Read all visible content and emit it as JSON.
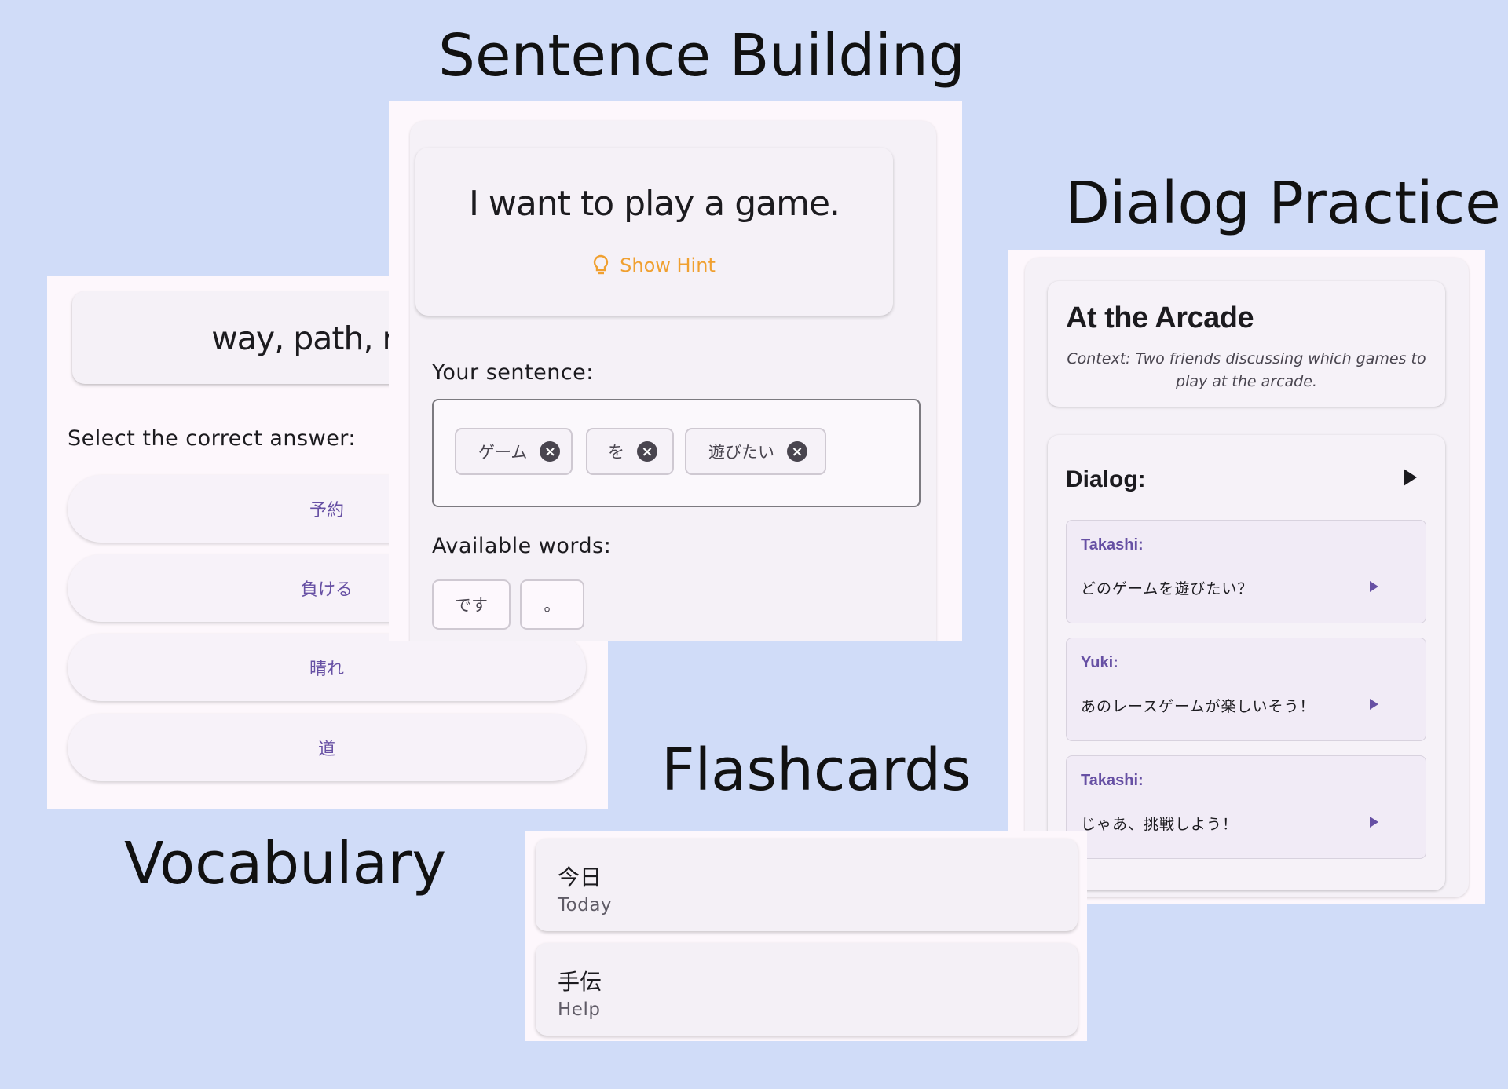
{
  "headings": {
    "sentence_building": "Sentence Building",
    "dialog_practice": "Dialog Practice",
    "flashcards": "Flashcards",
    "vocabulary": "Vocabulary"
  },
  "vocabulary": {
    "word": "way, path, road",
    "prompt": "Select the correct answer:",
    "options": [
      "予約",
      "負ける",
      "晴れ",
      "道"
    ]
  },
  "sentence_building": {
    "target": "I want to play a game.",
    "hint_label": "Show Hint",
    "your_sentence_label": "Your sentence:",
    "selected_words": [
      "ゲーム",
      "を",
      "遊びたい"
    ],
    "available_label": "Available words:",
    "available_words": [
      "です",
      "。"
    ]
  },
  "dialog": {
    "title": "At the Arcade",
    "context": "Context: Two friends discussing which games to play at the arcade.",
    "dialog_label": "Dialog:",
    "lines": [
      {
        "speaker": "Takashi:",
        "text": "どのゲームを遊びたい？"
      },
      {
        "speaker": "Yuki:",
        "text": "あのレースゲームが楽しいそう！"
      },
      {
        "speaker": "Takashi:",
        "text": "じゃあ、挑戦しよう！"
      }
    ]
  },
  "flashcards": [
    {
      "jp": "今日",
      "en": "Today"
    },
    {
      "jp": "手伝",
      "en": "Help"
    }
  ]
}
